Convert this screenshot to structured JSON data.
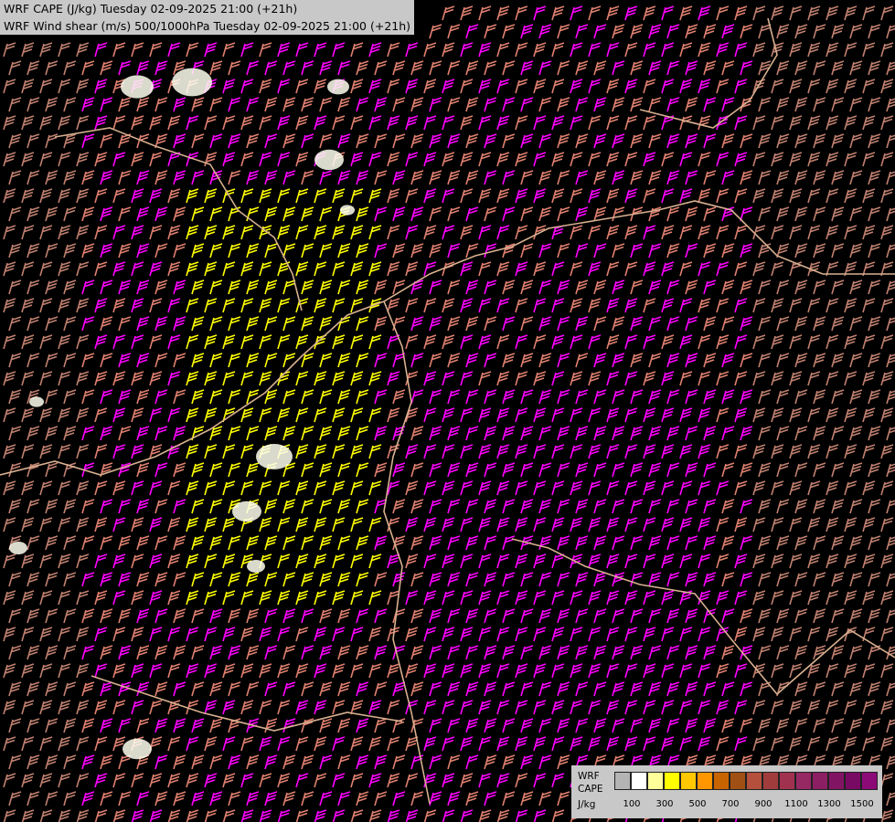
{
  "title": {
    "line1": "WRF CAPE (J/kg) Tuesday 02-09-2025 21:00 (+21h)",
    "line2": "WRF Wind shear (m/s) 500/1000hPa Tuesday 02-09-2025 21:00 (+21h)"
  },
  "legend": {
    "label1": "WRF",
    "label2": "CAPE",
    "label3": "J/kg",
    "colors": [
      "#b4b4b4",
      "#ffffff",
      "#ffff9a",
      "#ffff00",
      "#ffc800",
      "#ff9600",
      "#c86400",
      "#a05014",
      "#b4503c",
      "#a03c3c",
      "#a03250",
      "#962864",
      "#8c1e64",
      "#821464",
      "#780a64",
      "#8c0a78"
    ],
    "ticks": [
      "100",
      "300",
      "500",
      "700",
      "900",
      "1100",
      "1300",
      "1500"
    ]
  },
  "map": {
    "background": "#000000",
    "barb_colors": [
      "#ff00ff",
      "#ff7060",
      "#ffff00",
      "#c08070",
      "#e08070"
    ]
  }
}
